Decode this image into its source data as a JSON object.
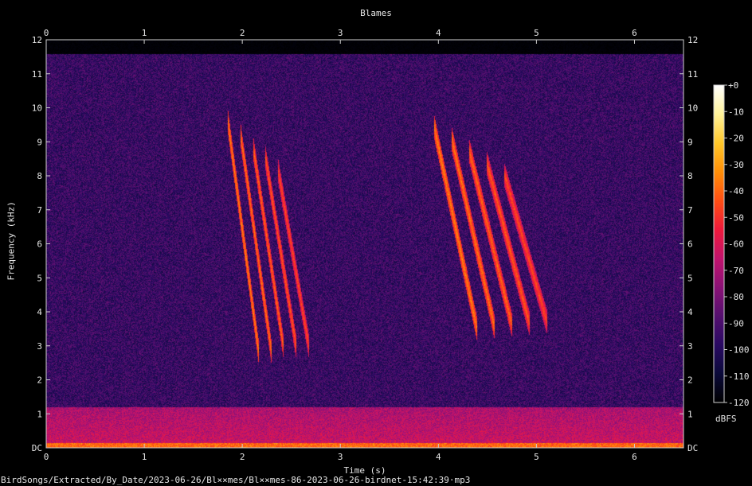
{
  "chart_data": {
    "type": "heatmap",
    "title": "Blames",
    "xlabel": "Time (s)",
    "ylabel": "Frequency (kHz)",
    "xlim": [
      0,
      6.5
    ],
    "ylim": [
      0,
      12
    ],
    "x_ticks": [
      "0",
      "1",
      "2",
      "3",
      "4",
      "5",
      "6"
    ],
    "y_ticks": [
      "DC",
      "1",
      "2",
      "3",
      "4",
      "5",
      "6",
      "7",
      "8",
      "9",
      "10",
      "11",
      "12"
    ],
    "colorbar": {
      "unit": "dBFS",
      "ticks": [
        "+0",
        "-10",
        "-20",
        "-30",
        "-40",
        "-50",
        "-60",
        "-70",
        "-80",
        "-90",
        "-100",
        "-110",
        "-120"
      ],
      "range": [
        -120,
        0
      ],
      "colors": [
        "#000000",
        "#0b0a3a",
        "#2a0a63",
        "#55106f",
        "#8a1276",
        "#c2146e",
        "#ee1a3c",
        "#ff4f15",
        "#ff8f08",
        "#ffc72a",
        "#fff39a",
        "#ffffff"
      ]
    },
    "calls": [
      {
        "start_s": 1.85,
        "end_s": 2.6,
        "top_khz": 9.6,
        "bottom_khz": 2.8
      },
      {
        "start_s": 3.95,
        "end_s": 5.0,
        "top_khz": 9.5,
        "bottom_khz": 3.5
      }
    ],
    "background_level_dbfs": -95,
    "low_band_level_dbfs": -70
  },
  "footer": {
    "path": "BirdSongs/Extracted/By_Date/2023-06-26/Bl××mes/Bl××mes-86-2023-06-26-birdnet-15:42:39·mp3"
  }
}
